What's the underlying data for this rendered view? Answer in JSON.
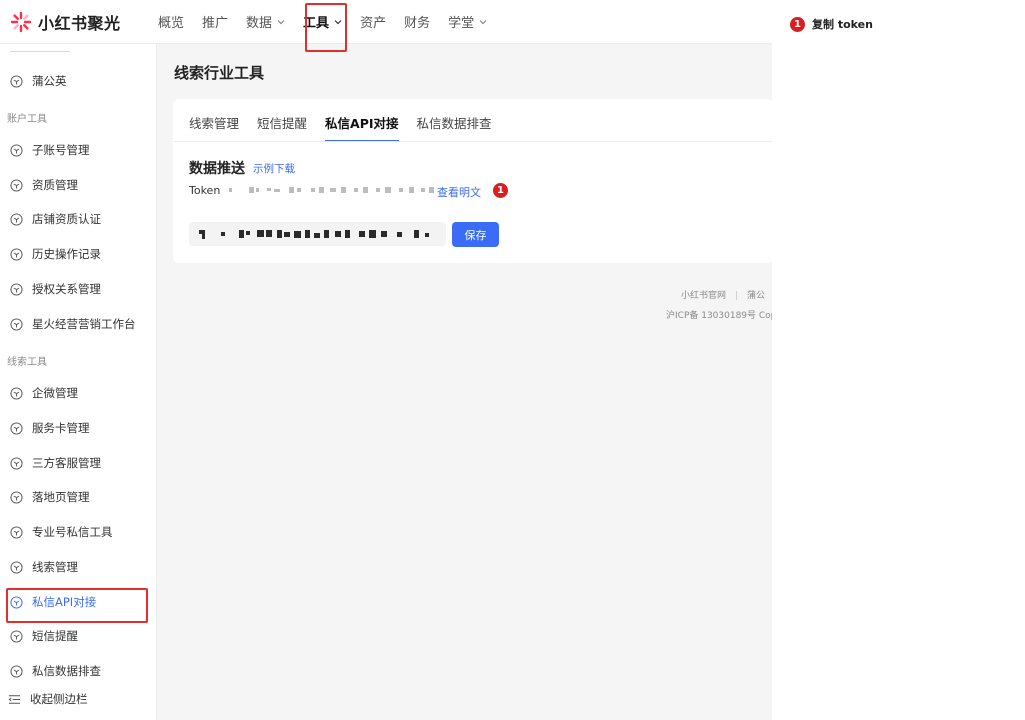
{
  "app": {
    "name": "小红书聚光"
  },
  "nav": {
    "items": [
      {
        "label": "概览",
        "dropdown": false,
        "active": false
      },
      {
        "label": "推广",
        "dropdown": false,
        "active": false
      },
      {
        "label": "数据",
        "dropdown": true,
        "active": false
      },
      {
        "label": "工具",
        "dropdown": true,
        "active": true
      },
      {
        "label": "资产",
        "dropdown": false,
        "active": false
      },
      {
        "label": "财务",
        "dropdown": false,
        "active": false
      },
      {
        "label": "学堂",
        "dropdown": true,
        "active": false
      }
    ]
  },
  "sidebar": {
    "top_item": "蒲公英",
    "section_account": "账户工具",
    "account_items": [
      "子账号管理",
      "资质管理",
      "店铺资质认证",
      "历史操作记录",
      "授权关系管理",
      "星火经营营销工作台"
    ],
    "section_leads": "线索工具",
    "leads_items": [
      "企微管理",
      "服务卡管理",
      "三方客服管理",
      "落地页管理",
      "专业号私信工具",
      "线索管理",
      "私信API对接",
      "短信提醒",
      "私信数据排查"
    ],
    "active_item": "私信API对接",
    "collapse_label": "收起侧边栏"
  },
  "main": {
    "page_title": "线索行业工具",
    "tabs": [
      "线索管理",
      "短信提醒",
      "私信API对接",
      "私信数据排查"
    ],
    "active_tab": "私信API对接",
    "section_title": "数据推送",
    "example_download": "示例下载",
    "token_label": "Token",
    "view_plain": "查看明文",
    "save_label": "保存"
  },
  "footer": {
    "link1": "小红书官网",
    "link2": "蒲公",
    "icp": "沪ICP备 13030189号 Cop"
  },
  "annotation": {
    "number": "1",
    "text": "复制 token"
  },
  "colors": {
    "accent": "#3b6cf6",
    "badge": "#d81e1e",
    "highlight_box": "#e0302b",
    "logo": "#ff2e4d"
  }
}
